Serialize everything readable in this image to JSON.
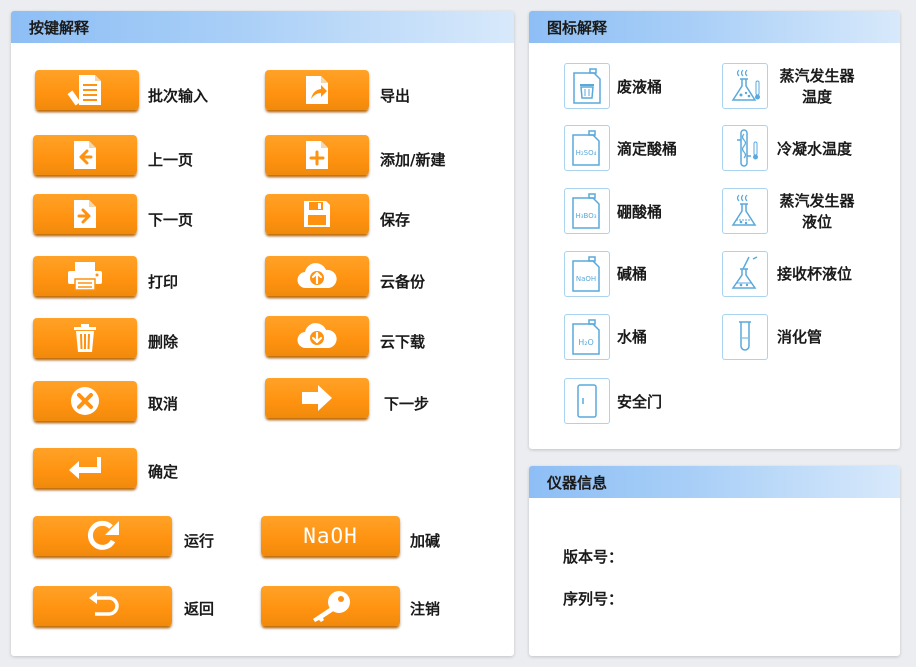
{
  "keys_panel": {
    "title": "按键解释",
    "buttons": {
      "batch_input": "批次输入",
      "export": "导出",
      "prev_page": "上一页",
      "add_new": "添加/新建",
      "next_page": "下一页",
      "save": "保存",
      "print": "打印",
      "cloud_backup": "云备份",
      "delete": "删除",
      "cloud_download": "云下载",
      "cancel": "取消",
      "next_step": "下一步",
      "confirm": "确定",
      "run": "运行",
      "add_naoh": "加碱",
      "naoh_text": "NaOH",
      "back": "返回",
      "logout": "注销"
    }
  },
  "icons_panel": {
    "title": "图标解释",
    "items": {
      "waste_bucket": "废液桶",
      "steam_temp_1": "蒸汽发生器",
      "steam_temp_2": "温度",
      "titrant_acid_bucket": "滴定酸桶",
      "condenser_temp": "冷凝水温度",
      "boric_acid_bucket": "硼酸桶",
      "steam_level_1": "蒸汽发生器",
      "steam_level_2": "液位",
      "alkali_bucket": "碱桶",
      "receiver_level": "接收杯液位",
      "water_bucket": "水桶",
      "digestion_tube": "消化管",
      "safety_door": "安全门"
    },
    "bucket_labels": {
      "h2so4": "H₂SO₄",
      "h3bo3": "H₃BO₃",
      "naoh": "NaOH",
      "h2o": "H₂O"
    }
  },
  "info_panel": {
    "title": "仪器信息",
    "version_label": "版本号：",
    "serial_label": "序列号："
  },
  "colors": {
    "button_orange": "#ff9210",
    "header_blue": "#8dbef5",
    "icon_border": "#a9d3ee",
    "icon_stroke": "#5aa9dc"
  }
}
